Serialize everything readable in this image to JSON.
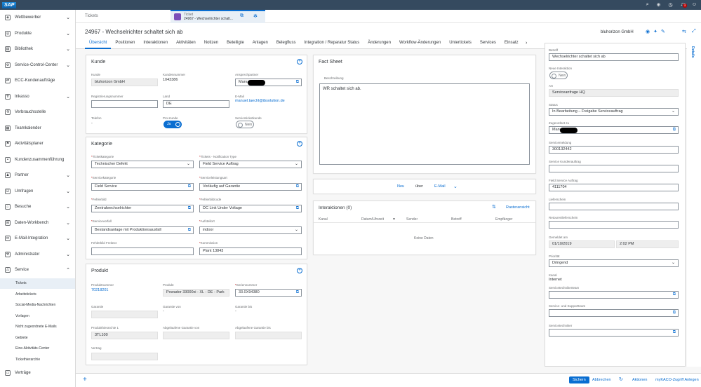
{
  "shell": {
    "logo": "SAP",
    "notif_count": "1"
  },
  "sidebar": {
    "items": [
      {
        "label": "Wettbewerber"
      },
      {
        "label": "Produkte"
      },
      {
        "label": "Bibliothek"
      },
      {
        "label": "Service-Control-Center"
      },
      {
        "label": "ECC-Kundenaufträge"
      },
      {
        "label": "Inkasso"
      },
      {
        "label": "Verbrauchsstelle"
      },
      {
        "label": "Teamkalender"
      },
      {
        "label": "Aktivitätsplaner"
      },
      {
        "label": "Kundenzusammenführung"
      },
      {
        "label": "Partner"
      },
      {
        "label": "Umfragen"
      },
      {
        "label": "Besuche"
      },
      {
        "label": "Daten-Workbench"
      },
      {
        "label": "E-Mail-Integration"
      },
      {
        "label": "Administrator"
      },
      {
        "label": "Service"
      }
    ],
    "subitems": [
      {
        "label": "Tickets"
      },
      {
        "label": "Arbeitstickets"
      },
      {
        "label": "Social-Media-Nachrichten"
      },
      {
        "label": "Vorlagen"
      },
      {
        "label": "Nicht zugeordnete E-Mails"
      },
      {
        "label": "Gebiete"
      },
      {
        "label": "Eine-Aktivitäts-Center"
      },
      {
        "label": "Tickethierarchie"
      }
    ],
    "last_item": "Verträge"
  },
  "tabs": {
    "tab1": "Tickets",
    "tab2_line1": "Ticket",
    "tab2_line2": "24967 - Wechselrichter schalt..."
  },
  "object": {
    "title": "24967 - Wechselrichter schaltet sich ab",
    "company": "bluhorizon GmbH",
    "subtabs": [
      "Übersicht",
      "Positionen",
      "Interaktionen",
      "Aktivitäten",
      "Notizen",
      "Beteiligte",
      "Anlagen",
      "Belegfluss",
      "Integration / Reparatur Status",
      "Änderungen",
      "Workflow-Änderungen",
      "Untertickets",
      "Services",
      "Einsatz"
    ]
  },
  "kunde": {
    "title": "Kunde",
    "kunde_label": "Kunde",
    "kunde_value": "bluhorizon GmbH",
    "kundennummer_label": "Kundennummer",
    "kundennummer_value": "1043386",
    "ansprechpartner_label": "Ansprechpartner",
    "ansprechpartner_value": "Manu",
    "reg_label": "Registrierungsnummer",
    "land_label": "Land",
    "land_value": "DE",
    "email_label": "E-Mail",
    "email_value": "manuel.taechl@ibsolution.de",
    "telefon_label": "Telefon",
    "telefon_value": "-",
    "pro_label": "Pro-Kunde",
    "pro_value": "Ja",
    "servicebkunde_label": "Serviceticketkunde",
    "servicebkunde_value": "Nein"
  },
  "kategorie": {
    "title": "Kategorie",
    "ticketkat_label": "Ticketkategorie",
    "ticketkat_value": "Technischer Defekt",
    "notif_label": "Tickets - Notification Type",
    "notif_value": "Field Service Auftrag",
    "servicekat_label": "Servicekategorie",
    "servicekat_value": "Field Service",
    "serviceleist_label": "Serviceleistungsart",
    "serviceleist_value": "Vorläufig auf Garantie",
    "fehlerbild_label": "Fehlerbild",
    "fehlerbild_value": "Zentralwechselrichter",
    "fehlercode_label": "Fehlerbildcode",
    "fehlercode_value": "DC Link Under Voltage",
    "servicevorfall_label": "Servicevorfall",
    "servicevorfall_value": "Bestandsanlage mit Produktionsausfall",
    "aufstellort_label": "Aufstellort",
    "aufstellort_value": "indoor",
    "freitext_label": "Fehlerbild Freitext",
    "kommission_label": "Kommission",
    "kommission_value": "Plant 13843"
  },
  "produkt": {
    "title": "Produkt",
    "nr_label": "Produktnummer",
    "nr_value": "70218201",
    "produkt_label": "Produkt",
    "produkt_value": "Powador 33000xi - XL - DE - Park",
    "serie_label": "Seriennummer",
    "serie_value": "33.0X94380",
    "garantie_label": "Garantie",
    "gvon_label": "Garantie von",
    "gvon_value": "-",
    "gbis_label": "Garantie bis",
    "gbis_value": "-",
    "hier_label": "Produkthierarchie 1",
    "hier_value": "3TL100",
    "abgvon_label": "Abgelaufene Garantie von",
    "abgbis_label": "Abgelaufene Garantie bis",
    "vertrag_label": "Vertrag"
  },
  "factsheet": {
    "title": "Fact Sheet",
    "beschr_label": "Beschreibung",
    "beschr_value": "WR schaltet sich ab."
  },
  "neu": {
    "neu_label": "Neu",
    "ueber_label": "über",
    "channel_label": "E-Mail"
  },
  "interaktionen": {
    "title": "Interaktionen (0)",
    "raster_label": "Rasteransicht",
    "columns": [
      "Kanal",
      "Datum/Uhrzeit",
      "Sender",
      "Betreff",
      "Empfänger"
    ],
    "empty_text": "Keine Daten"
  },
  "details": {
    "tab_label": "Details",
    "betreff_label": "Betreff",
    "betreff_value": "Wechselrichter schaltet sich ab",
    "neueint_label": "Neue Interaktion",
    "neueint_value": "Nein",
    "art_label": "Art",
    "art_value": "Serviceanfrage HQ",
    "status_label": "Status",
    "status_value": "In Bearbeitung – Freigabe Serviceauftrag",
    "zug_label": "Zugeordnet zu",
    "zug_value": "Manu",
    "servicemeld_label": "Servicemeldung",
    "servicemeld_value": "300132442",
    "servicekauf_label": "Service Kundenauftrag",
    "fieldkauf_label": "Field Service Auftrag",
    "fieldkauf_value": "4111704",
    "lieferschein_label": "Lieferschein",
    "retour_label": "Retourenlieferschein",
    "gemeldet_label": "Gemeldet am",
    "gemeldet_date": "01/10/2019",
    "gemeldet_time": "2:02 PM",
    "prio_label": "Priorität",
    "prio_value": "Dringend",
    "kanal_label": "Kanal",
    "kanal_value": "Internet",
    "techteam_label": "Servicetechnikerteam",
    "support_label": "Service- und Supportteam",
    "techniker_label": "Servicetechniker"
  },
  "footer": {
    "save": "Sichern",
    "cancel": "Abbrechen",
    "actions": "Aktionen",
    "mykaco": "myKACO-Zugriff Anlegen"
  }
}
